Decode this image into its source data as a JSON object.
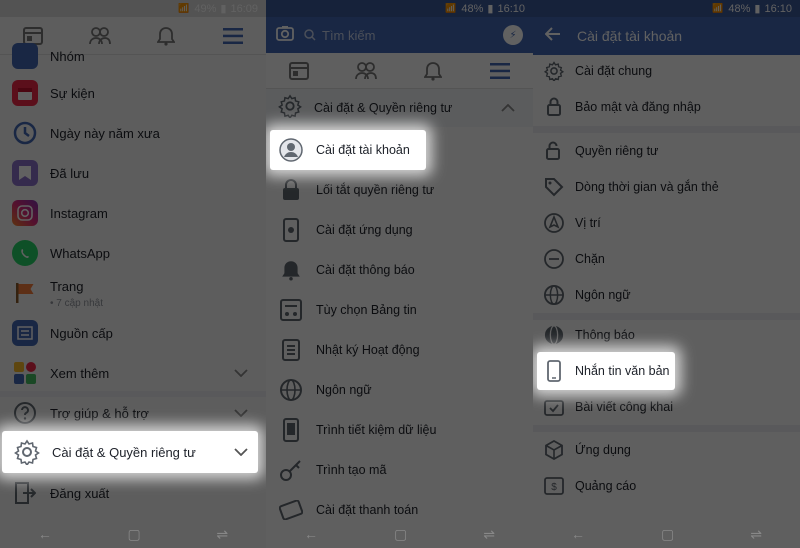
{
  "screen1": {
    "status": {
      "signal": "wifi ▾ .ıl",
      "battery": "49%",
      "time": "16:09"
    },
    "nav_icons": [
      "news-feed-icon",
      "friends-icon",
      "bell-icon",
      "menu-icon"
    ],
    "items": [
      {
        "label": "Nhóm",
        "icon": "groups-icon",
        "color": "#4267b2"
      },
      {
        "label": "Sự kiện",
        "icon": "calendar-icon",
        "color": "#f02849"
      },
      {
        "label": "Ngày này năm xưa",
        "icon": "memories-icon",
        "color": "#4267b2"
      },
      {
        "label": "Đã lưu",
        "icon": "saved-icon",
        "color": "#8c72cb"
      },
      {
        "label": "Instagram",
        "icon": "instagram-icon",
        "color": "#c13584"
      },
      {
        "label": "WhatsApp",
        "icon": "whatsapp-icon",
        "color": "#25d366"
      },
      {
        "label": "Trang",
        "sub": "• 7 cập nhật",
        "icon": "flag-icon",
        "color": "#f57b3b"
      },
      {
        "label": "Nguồn cấp",
        "icon": "feed-icon",
        "color": "#4267b2"
      },
      {
        "label": "Xem thêm",
        "icon": "see-more-icon",
        "color": "#f7b928"
      }
    ],
    "help": "Trợ giúp & hỗ trợ",
    "settings": "Cài đặt & Quyền riêng tư",
    "logout": "Đăng xuất"
  },
  "screen2": {
    "status": {
      "battery": "48%",
      "time": "16:10"
    },
    "search_placeholder": "Tìm kiếm",
    "section": "Cài đặt & Quyền riêng tư",
    "items": [
      {
        "label": "Cài đặt tài khoản",
        "icon": "account-icon"
      },
      {
        "label": "Lối tắt quyền riêng tư",
        "icon": "lock-icon"
      },
      {
        "label": "Cài đặt ứng dụng",
        "icon": "phone-settings-icon"
      },
      {
        "label": "Cài đặt thông báo",
        "icon": "bell-icon"
      },
      {
        "label": "Tùy chọn Bảng tin",
        "icon": "feed-prefs-icon"
      },
      {
        "label": "Nhật ký Hoạt động",
        "icon": "activity-log-icon"
      },
      {
        "label": "Ngôn ngữ",
        "icon": "globe-icon"
      },
      {
        "label": "Trình tiết kiệm dữ liệu",
        "icon": "data-saver-icon"
      },
      {
        "label": "Trình tạo mã",
        "icon": "key-icon"
      },
      {
        "label": "Cài đặt thanh toán",
        "icon": "payment-icon"
      }
    ]
  },
  "screen3": {
    "status": {
      "battery": "48%",
      "time": "16:10"
    },
    "title": "Cài đặt tài khoản",
    "items": [
      {
        "label": "Cài đặt chung",
        "icon": "gear-icon"
      },
      {
        "label": "Bảo mật và đăng nhập",
        "icon": "shield-lock-icon"
      },
      {
        "label": "Quyền riêng tư",
        "icon": "privacy-lock-icon"
      },
      {
        "label": "Dòng thời gian và gắn thẻ",
        "icon": "tag-icon"
      },
      {
        "label": "Vị trí",
        "icon": "location-icon"
      },
      {
        "label": "Chặn",
        "icon": "block-icon"
      },
      {
        "label": "Ngôn ngữ",
        "icon": "globe-icon"
      },
      {
        "label": "Thông báo",
        "icon": "notification-globe-icon"
      },
      {
        "label": "Nhắn tin văn bản",
        "icon": "mobile-icon"
      },
      {
        "label": "Bài viết công khai",
        "icon": "public-posts-icon"
      },
      {
        "label": "Ứng dụng",
        "icon": "apps-icon"
      },
      {
        "label": "Quảng cáo",
        "icon": "ads-icon"
      }
    ]
  }
}
